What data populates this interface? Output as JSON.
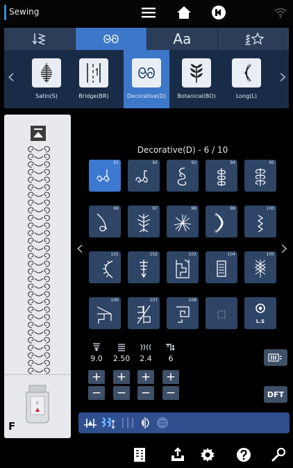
{
  "app": {
    "title": "Sewing"
  },
  "topbar": {
    "icons": [
      "menu-icon",
      "home-icon",
      "stop-icon",
      "wifi-icon"
    ]
  },
  "category_tabs": [
    {
      "icon": "utility-stitch-icon",
      "label": ""
    },
    {
      "icon": "decorative-stitch-icon",
      "label": ""
    },
    {
      "icon": "font-icon",
      "label": "Aa"
    },
    {
      "icon": "favorite-stitch-icon",
      "label": ""
    }
  ],
  "subcategories": [
    {
      "label": "Satin(S)",
      "icon": "satin-icon"
    },
    {
      "label": "Bridge(BR)",
      "icon": "bridge-icon"
    },
    {
      "label": "Decorative(D)",
      "icon": "decorative-icon",
      "selected": true
    },
    {
      "label": "Botanical(BO)",
      "icon": "botanical-icon"
    },
    {
      "label": "Long(L)",
      "icon": "long-icon"
    }
  ],
  "grid": {
    "title": "Decorative(D) - 6 / 10",
    "stitches": [
      {
        "num": "91",
        "selected": true
      },
      {
        "num": "92"
      },
      {
        "num": "93"
      },
      {
        "num": "94"
      },
      {
        "num": "95"
      },
      {
        "num": "96"
      },
      {
        "num": "97"
      },
      {
        "num": "98"
      },
      {
        "num": "99"
      },
      {
        "num": "100"
      },
      {
        "num": "101"
      },
      {
        "num": "102"
      },
      {
        "num": "103"
      },
      {
        "num": "104"
      },
      {
        "num": "105"
      },
      {
        "num": "106"
      },
      {
        "num": "107"
      },
      {
        "num": "108"
      },
      {
        "num": ""
      },
      {
        "num": "",
        "label": "L.S"
      }
    ]
  },
  "parameters": [
    {
      "icon": "width-icon",
      "value": "9.0"
    },
    {
      "icon": "length-icon",
      "value": "2.50"
    },
    {
      "icon": "density-icon",
      "value": "2.4"
    },
    {
      "icon": "tension-icon",
      "value": "6"
    }
  ],
  "side": {
    "dft_label": "DFT"
  },
  "preview": {
    "foot_label": "F"
  },
  "toolbar_icons": [
    "needle-stop-icon",
    "feed-icon",
    "mirror-vertical-icon",
    "mirror-horizontal-icon",
    "restart-icon"
  ],
  "bottomnav_icons": [
    "stitch-chart-icon",
    "memory-icon",
    "settings-icon",
    "help-icon",
    "wrench-icon"
  ]
}
